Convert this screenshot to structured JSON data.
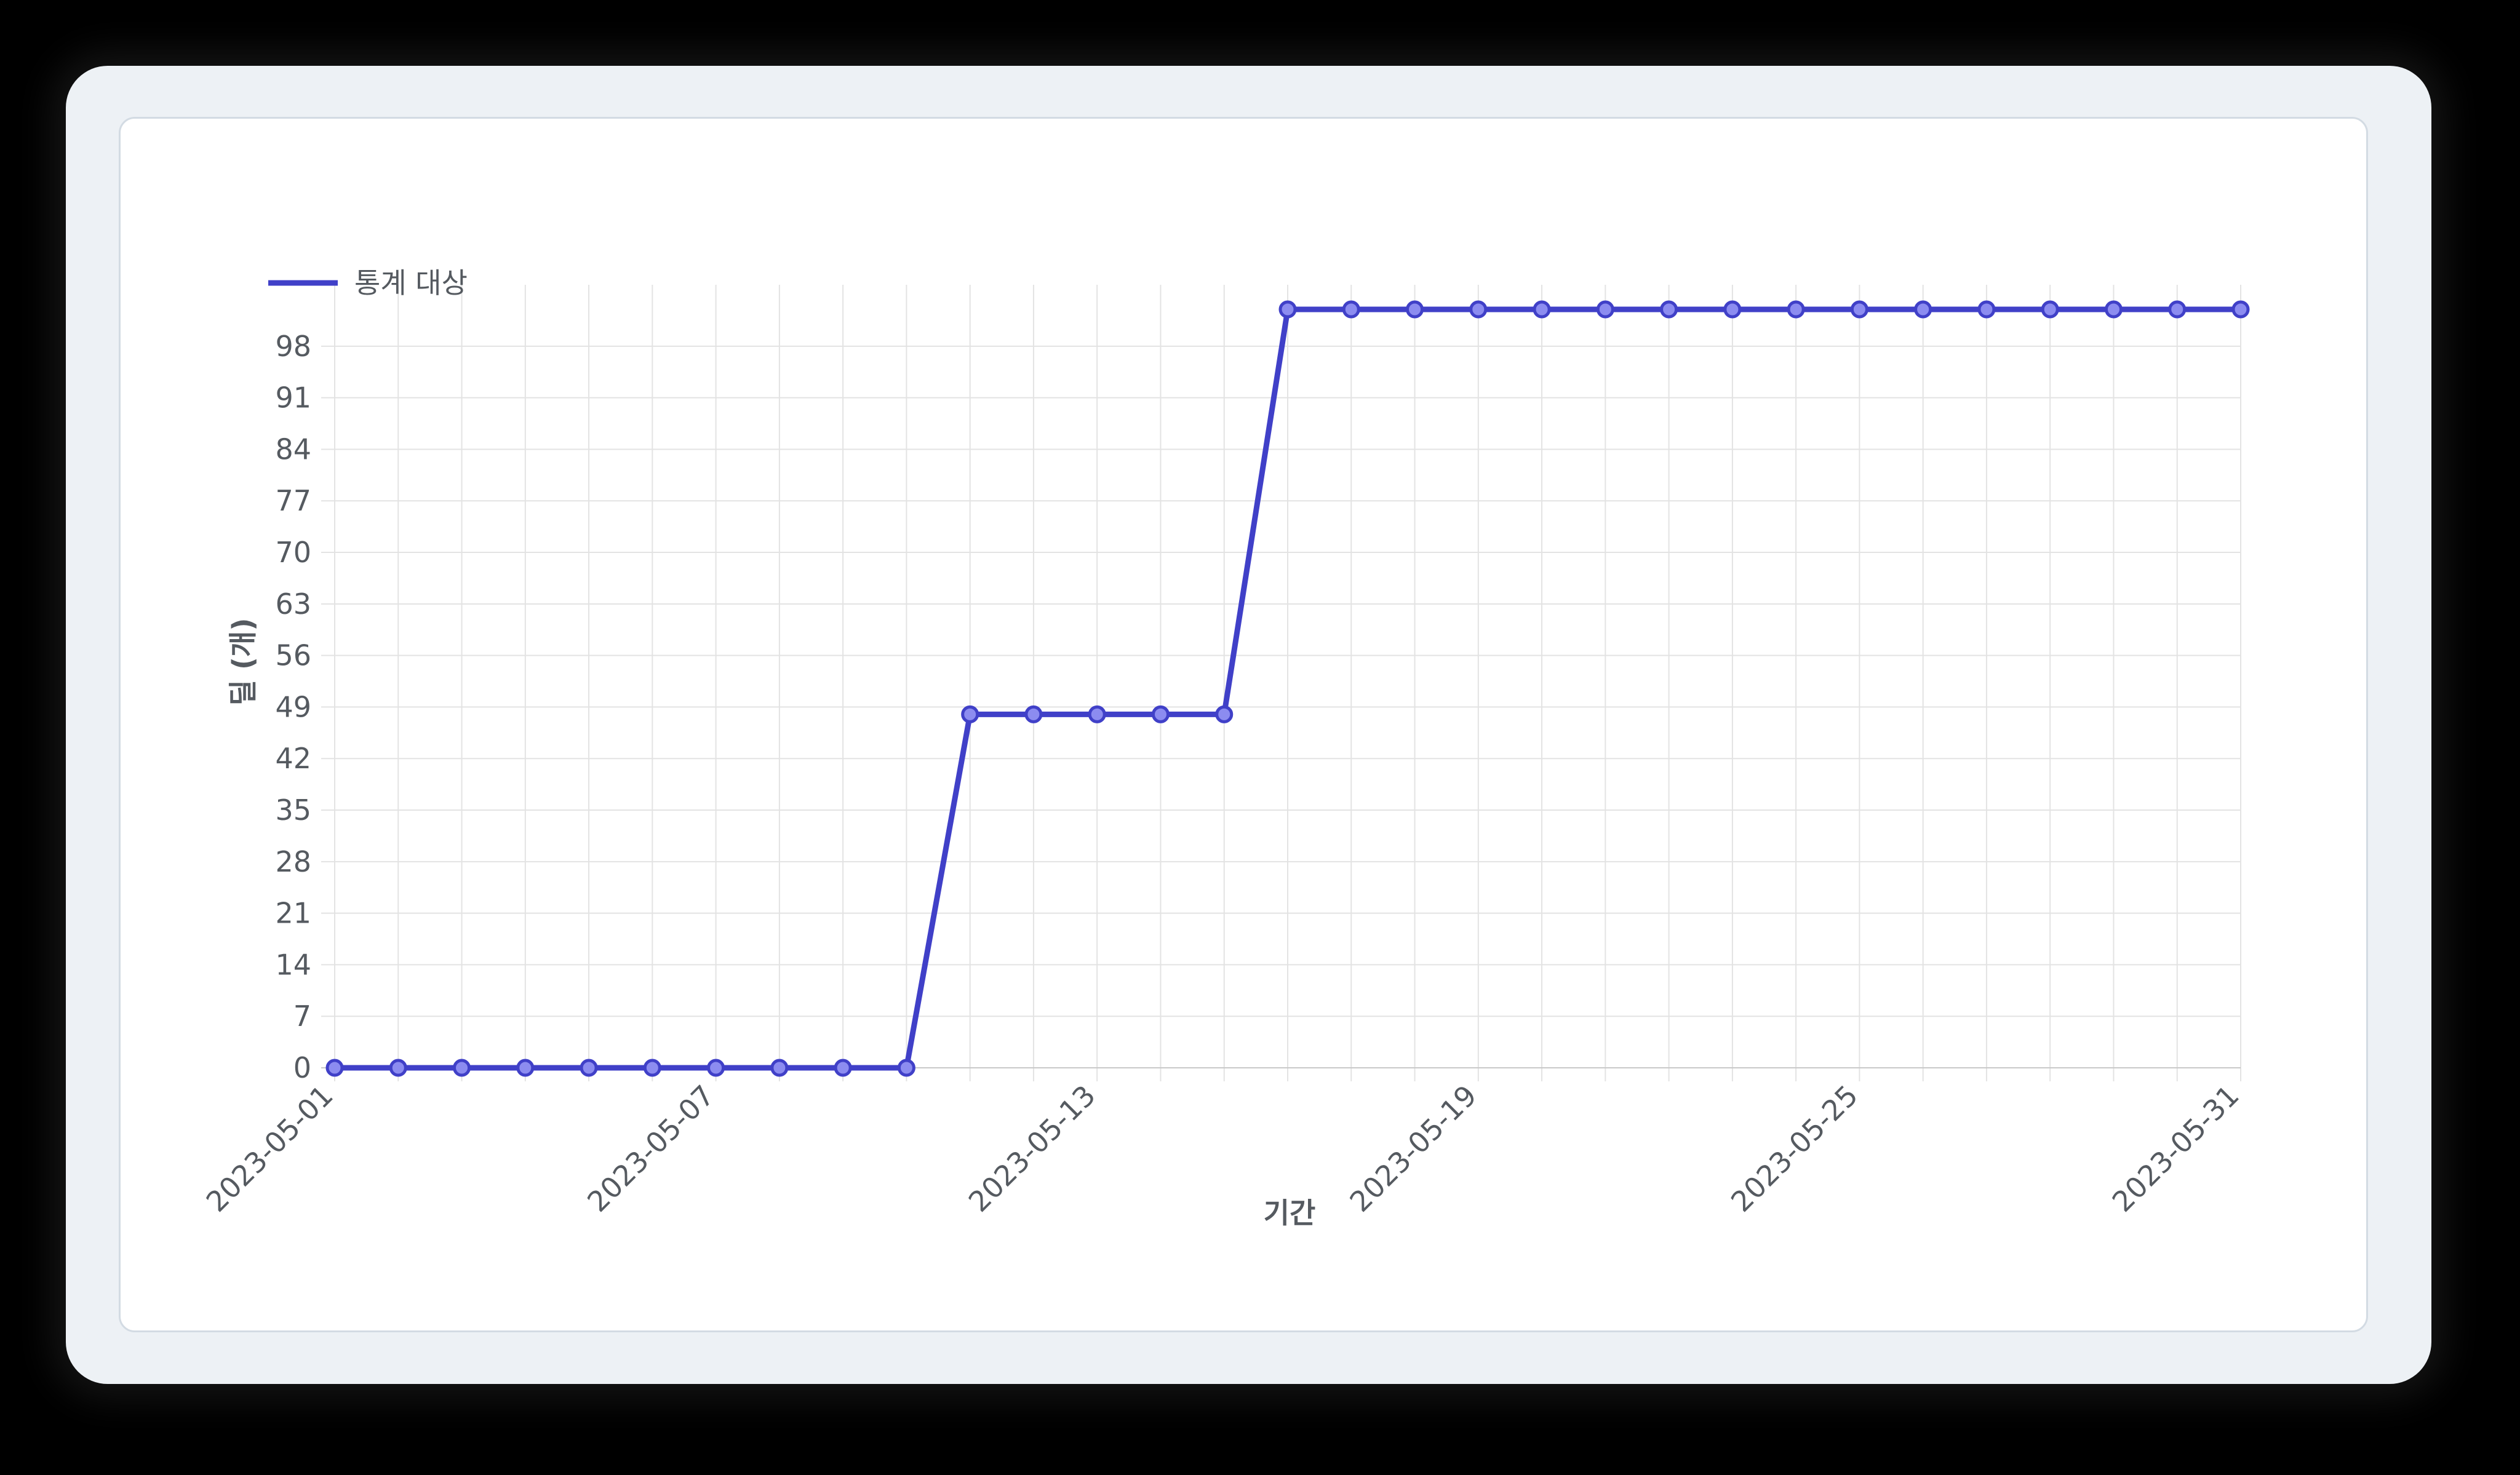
{
  "chart_data": {
    "type": "line",
    "ylabel": "딜 (개)",
    "xlabel": "기간",
    "legend": {
      "position": "top-left",
      "entries": [
        "통계 대상"
      ]
    },
    "grid": true,
    "ylim": [
      0,
      103
    ],
    "yticks": [
      0,
      7,
      14,
      21,
      28,
      35,
      42,
      49,
      56,
      63,
      70,
      77,
      84,
      91,
      98
    ],
    "x_tick_labels": [
      "2023-05-01",
      "2023-05-07",
      "2023-05-13",
      "2023-05-19",
      "2023-05-25",
      "2023-05-31"
    ],
    "x": [
      "2023-05-01",
      "2023-05-02",
      "2023-05-03",
      "2023-05-04",
      "2023-05-05",
      "2023-05-06",
      "2023-05-07",
      "2023-05-08",
      "2023-05-09",
      "2023-05-10",
      "2023-05-11",
      "2023-05-12",
      "2023-05-13",
      "2023-05-14",
      "2023-05-15",
      "2023-05-16",
      "2023-05-17",
      "2023-05-18",
      "2023-05-19",
      "2023-05-20",
      "2023-05-21",
      "2023-05-22",
      "2023-05-23",
      "2023-05-24",
      "2023-05-25",
      "2023-05-26",
      "2023-05-27",
      "2023-05-28",
      "2023-05-29",
      "2023-05-30",
      "2023-05-31"
    ],
    "series": [
      {
        "name": "통계 대상",
        "color": "#4040c8",
        "point_fill": "#8c8cf0",
        "values": [
          0,
          0,
          0,
          0,
          0,
          0,
          0,
          0,
          0,
          0,
          48,
          48,
          48,
          48,
          48,
          103,
          103,
          103,
          103,
          103,
          103,
          103,
          103,
          103,
          103,
          103,
          103,
          103,
          103,
          103,
          103
        ]
      }
    ]
  }
}
